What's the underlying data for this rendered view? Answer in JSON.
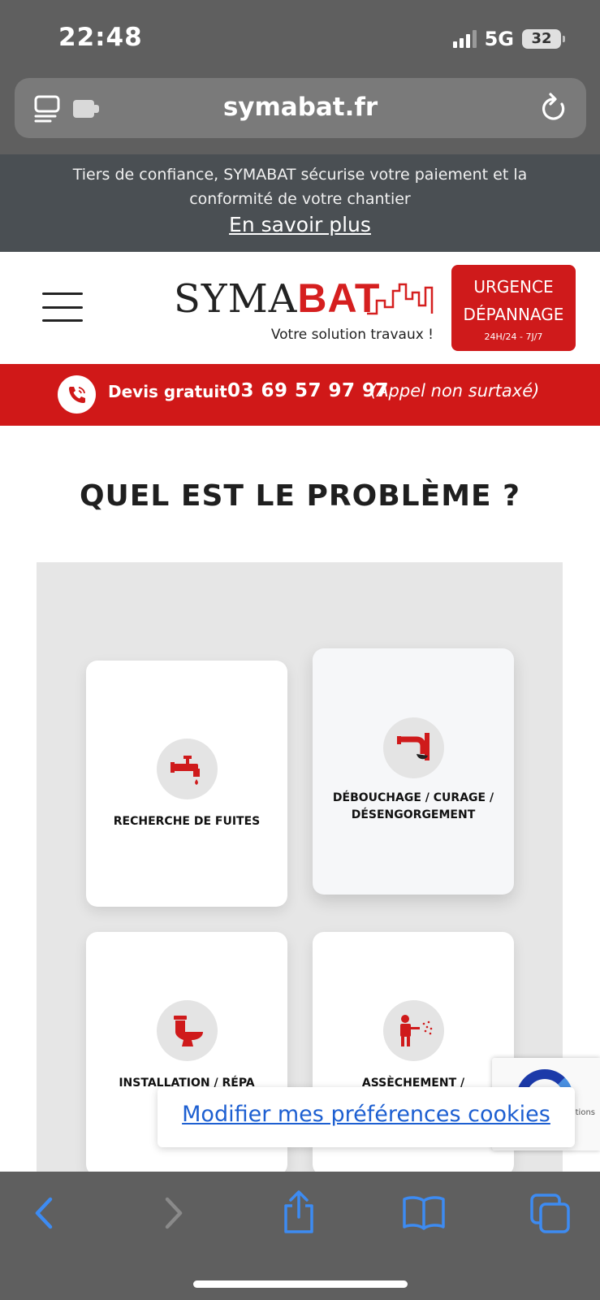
{
  "status": {
    "time": "22:48",
    "network": "5G",
    "battery": "32"
  },
  "browser": {
    "url": "symabat.fr"
  },
  "announcement": {
    "text": "Tiers de confiance, SYMABAT sécurise votre paiement et la conformité de votre chantier",
    "link": "En savoir plus"
  },
  "header": {
    "logo_prefix": "SYMA",
    "logo_suffix": "BAT",
    "tagline": "Votre solution travaux !",
    "urgence_line1": "URGENCE",
    "urgence_line2": "DÉPANNAGE",
    "urgence_hours": "24H/24 - 7J/7"
  },
  "phonebar": {
    "label": "Devis gratuit",
    "number": "03 69 57 97 97",
    "note": "(Appel non surtaxé)"
  },
  "section": {
    "title": "QUEL EST LE PROBLÈME ?",
    "cards": [
      {
        "label": "RECHERCHE DE FUITES",
        "icon": "faucet-icon"
      },
      {
        "label": "DÉBOUCHAGE / CURAGE / DÉSENGORGEMENT",
        "icon": "pipe-icon"
      },
      {
        "label": "INSTALLATION / RÉPA",
        "icon": "toilet-icon"
      },
      {
        "label": "ASSÈCHEMENT /",
        "icon": "sprayer-icon"
      }
    ]
  },
  "cookie": {
    "label": "Modifier mes préférences cookies"
  },
  "recaptcha": {
    "text": "itions"
  },
  "colors": {
    "brand_red": "#d01818",
    "panel_grey": "#e6e6e6",
    "link_blue": "#1d5fd1"
  }
}
